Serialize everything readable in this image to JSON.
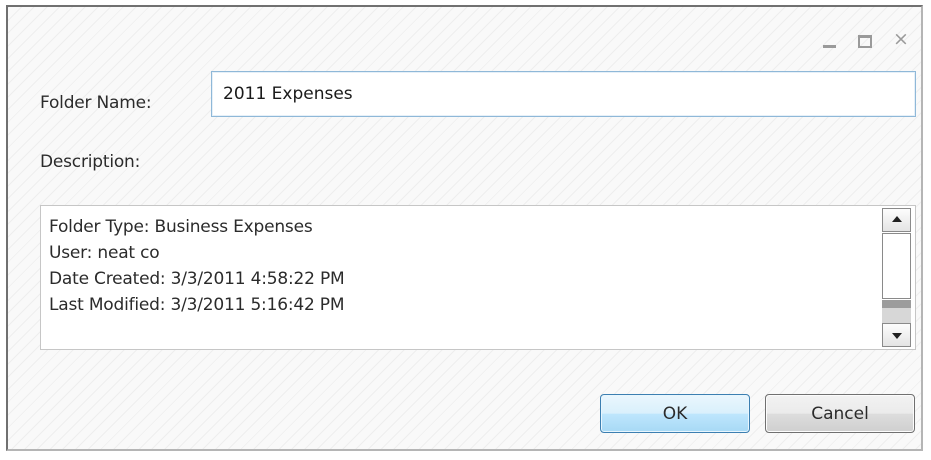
{
  "window": {
    "controls": {
      "minimize": "minimize-icon",
      "maximize": "maximize-icon",
      "close": "close-icon"
    }
  },
  "form": {
    "folder_name_label": "Folder Name:",
    "folder_name_value": "2011 Expenses",
    "description_label": "Description:",
    "description_lines": [
      "Folder Type: Business Expenses",
      "User: neat co",
      "Date Created: 3/3/2011 4:58:22 PM",
      "Last Modified: 3/3/2011 5:16:42 PM"
    ]
  },
  "buttons": {
    "ok_label": "OK",
    "cancel_label": "Cancel"
  },
  "colors": {
    "ok_border": "#3c7fb1",
    "input_border": "#8fb8d8"
  }
}
